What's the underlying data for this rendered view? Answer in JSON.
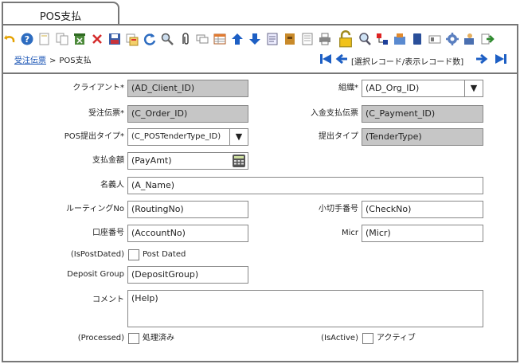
{
  "window": {
    "tab_title": "POS支払"
  },
  "toolbar": {
    "icons": [
      "undo-icon",
      "help-icon",
      "new-record-icon",
      "copy-record-icon",
      "delete-multi-icon",
      "delete-icon",
      "save-icon",
      "grid-toggle-icon",
      "refresh-icon",
      "find-icon",
      "attachment-icon",
      "chat-icon",
      "multi-row-icon",
      "first-parent-icon",
      "detail-icon",
      "history-icon",
      "archive-icon",
      "print-preview-icon",
      "print-icon",
      "lock-icon",
      "zoom-across-icon",
      "workflow-icon",
      "product-info-icon",
      "archived-docs-icon",
      "request-icon",
      "process-icon",
      "export-icon",
      "end-icon"
    ]
  },
  "breadcrumb": {
    "parent": "受注伝票",
    "separator": ">",
    "current": "POS支払"
  },
  "navigation": {
    "record_text": "[選択レコード/表示レコード数]"
  },
  "fields": {
    "client_label": "クライアント*",
    "client_value": "(AD_Client_ID)",
    "org_label": "組織*",
    "org_value": "(AD_Org_ID)",
    "order_label": "受注伝票*",
    "order_value": "(C_Order_ID)",
    "payment_label": "入金支払伝票",
    "payment_value": "(C_Payment_ID)",
    "tendertype_id_label": "POS提出タイプ*",
    "tendertype_id_value": "(C_POSTenderType_ID)",
    "tendertype_label": "提出タイプ",
    "tendertype_value": "(TenderType)",
    "payamt_label": "支払金額",
    "payamt_value": "(PayAmt)",
    "aname_label": "名義人",
    "aname_value": "(A_Name)",
    "routing_label": "ルーティングNo",
    "routing_value": "(RoutingNo)",
    "check_label": "小切手番号",
    "check_value": "(CheckNo)",
    "account_label": "口座番号",
    "account_value": "(AccountNo)",
    "micr_label": "Micr",
    "micr_value": "(Micr)",
    "postdated_label": "(IsPostDated)",
    "postdated_text": "Post Dated",
    "depositgroup_label": "Deposit Group",
    "depositgroup_value": "(DepositGroup)",
    "comment_label": "コメント",
    "comment_value": "(Help)",
    "processed_label": "(Processed)",
    "processed_text": "処理済み",
    "active_label": "(IsActive)",
    "active_text": "アクティブ"
  },
  "colors": {
    "accent": "#1b55b5",
    "readonly": "#c6c6c6",
    "border": "#777777"
  }
}
